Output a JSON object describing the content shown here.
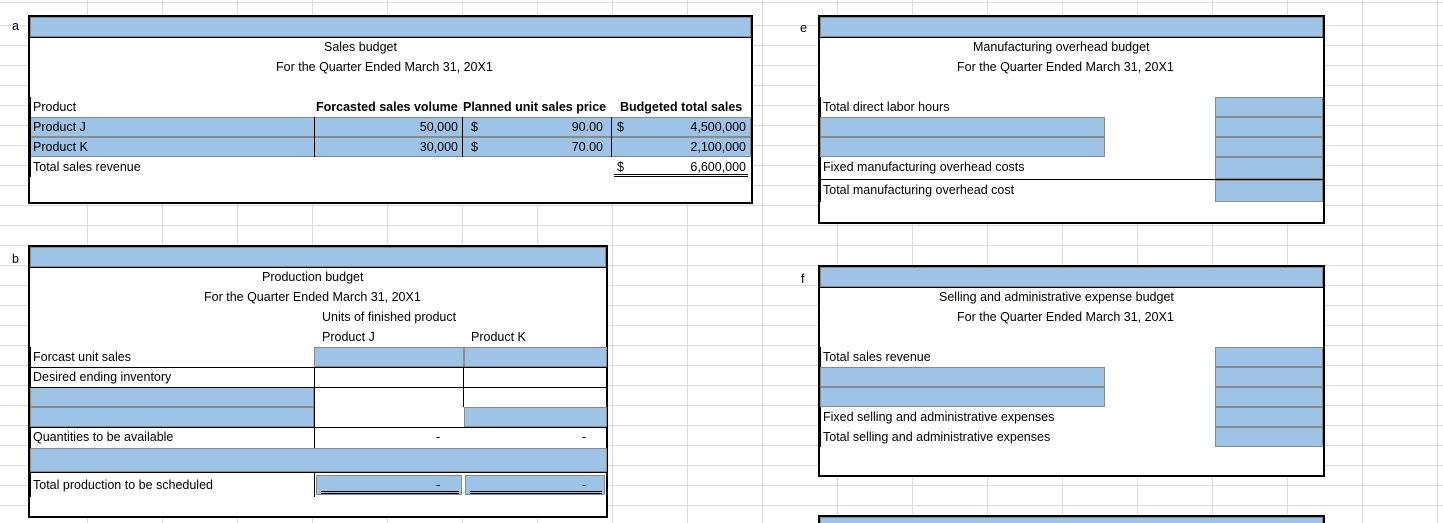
{
  "section_letters": {
    "a": "a",
    "b": "b",
    "e": "e",
    "f": "f"
  },
  "sales_budget": {
    "title": "Sales budget",
    "subtitle": "For the Quarter Ended March 31, 20X1",
    "headers": {
      "product": "Product",
      "volume": "Forcasted sales volume",
      "price": "Planned unit sales price",
      "total": "Budgeted total sales"
    },
    "rows": [
      {
        "product": "Product J",
        "volume": "50,000",
        "currency": "$",
        "price": "90.00",
        "total_currency": "$",
        "total": "4,500,000"
      },
      {
        "product": "Product K",
        "volume": "30,000",
        "currency": "$",
        "price": "70.00",
        "total_currency": "",
        "total": "2,100,000"
      }
    ],
    "total_row": {
      "label": "Total sales revenue",
      "currency": "$",
      "value": "6,600,000"
    }
  },
  "production_budget": {
    "title": "Production budget",
    "subtitle": "For the Quarter Ended March 31, 20X1",
    "units_header": "Units of finished product",
    "col_j": "Product J",
    "col_k": "Product K",
    "rows": {
      "forecast": "Forcast unit sales",
      "ending": "Desired ending inventory",
      "available": "Quantities to be available",
      "total": "Total production to be scheduled"
    },
    "dash": "-"
  },
  "overhead_budget": {
    "title": "Manufacturing overhead budget",
    "subtitle": "For the Quarter Ended March 31, 20X1",
    "rows": {
      "labor": "Total direct labor hours",
      "fixed": "Fixed manufacturing overhead costs",
      "total": "Total manufacturing overhead cost"
    }
  },
  "selling_budget": {
    "title": "Selling and administrative expense budget",
    "subtitle": "For the Quarter Ended March 31, 20X1",
    "rows": {
      "revenue": "Total sales revenue",
      "fixed": "Fixed selling and administrative expenses",
      "total": "Total selling and administrative expenses"
    }
  }
}
